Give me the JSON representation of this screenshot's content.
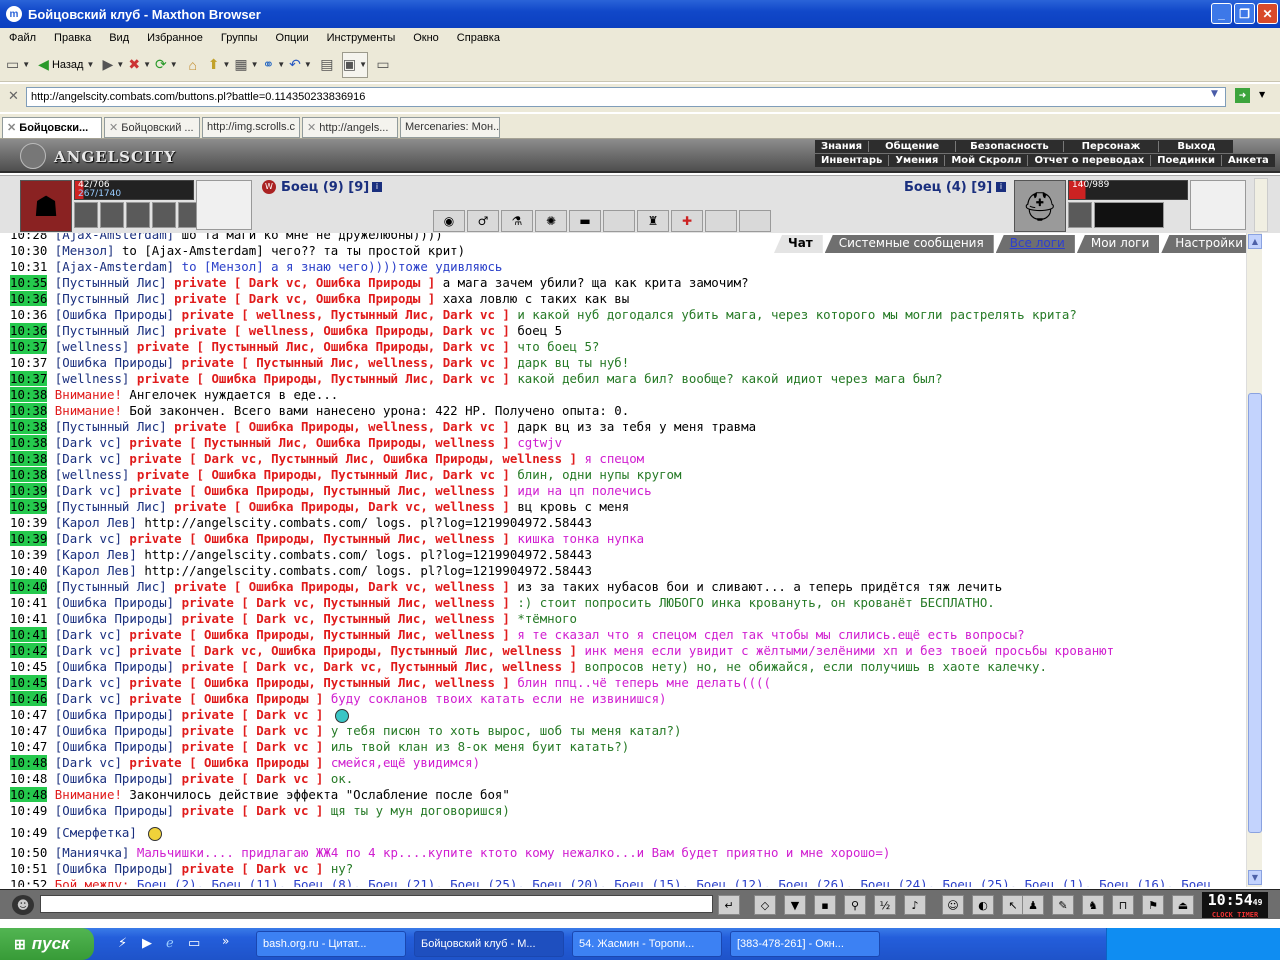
{
  "window": {
    "title": "Бойцовский клуб - Maxthon Browser",
    "app_icon": "m"
  },
  "menu": [
    "Файл",
    "Правка",
    "Вид",
    "Избранное",
    "Группы",
    "Опции",
    "Инструменты",
    "Окно",
    "Справка"
  ],
  "toolbar": {
    "back_label": "Назад"
  },
  "address": {
    "url": "http://angelscity.combats.com/buttons.pl?battle=0.114350233836916"
  },
  "tabs": [
    "Бойцовски...",
    "Бойцовский ...",
    "http://img.scrolls.c",
    "http://angels...",
    "Mercenaries: Мон..."
  ],
  "game": {
    "logo": "ANGELSCITY",
    "nav_top": [
      "Знания",
      "Общение",
      "Безопасность",
      "Персонаж",
      "Выход"
    ],
    "nav_bottom": [
      "Инвентарь",
      "Умения",
      "Мой Скролл",
      "Отчет о переводах",
      "Поединки",
      "Анкета"
    ],
    "left_fighter": {
      "name": "Боец (9) [9]",
      "hp": "42/706",
      "mana": "267/1740"
    },
    "right_fighter": {
      "name": "Боец (4) [9]",
      "hp": "140/989"
    }
  },
  "chat_tabs": [
    "Чат",
    "Системные сообщения",
    "Все логи",
    "Мои логи",
    "Настройки"
  ],
  "chat": [
    {
      "time": "10:28",
      "hl": false,
      "nick": "[Ajax-Amsterdam]",
      "text": "шо та маги ко мне не дружелюбны))))",
      "cls": "msg-default"
    },
    {
      "time": "10:30",
      "hl": false,
      "nick": "[Мензол]",
      "text": "to [Ajax-Amsterdam] чего?? та ты простой крит)",
      "cls": "msg-default"
    },
    {
      "time": "10:31",
      "hl": false,
      "nick": "[Ajax-Amsterdam]",
      "text": "to [Мензол] а я знаю чего))))тоже удивляюсь",
      "cls": "msg-blue"
    },
    {
      "time": "10:35",
      "hl": true,
      "nick": "[Пустынный Лис]",
      "priv": "private [ Dark vc, Ошибка Природы ]",
      "text": "а мага зачем убили? ща как крита замочим?",
      "cls": "msg-default"
    },
    {
      "time": "10:36",
      "hl": true,
      "nick": "[Пустынный Лис]",
      "priv": "private [ Dark vc, Ошибка Природы ]",
      "text": "хаха ловлю с таких как вы",
      "cls": "msg-default"
    },
    {
      "time": "10:36",
      "hl": false,
      "nick": "[Ошибка Природы]",
      "priv": "private [ wellness, Пустынный Лис, Dark vc ]",
      "text": "и какой нуб догодался убить мага, через которого мы могли растрелять крита?",
      "cls": "msg-green"
    },
    {
      "time": "10:36",
      "hl": true,
      "nick": "[Пустынный Лис]",
      "priv": "private [ wellness, Ошибка Природы, Dark vc ]",
      "text": "боец 5",
      "cls": "msg-default"
    },
    {
      "time": "10:37",
      "hl": true,
      "nick": "[wellness]",
      "priv": "private [ Пустынный Лис, Ошибка Природы, Dark vc ]",
      "text": "что боец 5?",
      "cls": "msg-green"
    },
    {
      "time": "10:37",
      "hl": false,
      "nick": "[Ошибка Природы]",
      "priv": "private [ Пустынный Лис, wellness, Dark vc ]",
      "text": "дарк вц ты нуб!",
      "cls": "msg-green"
    },
    {
      "time": "10:37",
      "hl": true,
      "nick": "[wellness]",
      "priv": "private [ Ошибка Природы, Пустынный Лис, Dark vc ]",
      "text": "какой дебил мага бил? вообще? какой идиот через мага был?",
      "cls": "msg-green"
    },
    {
      "time": "10:38",
      "hl": true,
      "att": "Внимание!",
      "text": "Ангелочек нуждается в еде...",
      "cls": "msg-default"
    },
    {
      "time": "10:38",
      "hl": true,
      "att": "Внимание!",
      "text": "Бой закончен. Всего вами нанесено урона: 422 HP. Получено опыта: 0.",
      "cls": "msg-default"
    },
    {
      "time": "10:38",
      "hl": true,
      "nick": "[Пустынный Лис]",
      "priv": "private [ Ошибка Природы, wellness, Dark vc ]",
      "text": "дарк вц из за тебя у меня травма",
      "cls": "msg-default"
    },
    {
      "time": "10:38",
      "hl": true,
      "nick": "[Dark vc]",
      "priv": "private [ Пустынный Лис, Ошибка Природы, wellness ]",
      "text": "cgtwjv",
      "cls": "msg-pink"
    },
    {
      "time": "10:38",
      "hl": true,
      "nick": "[Dark vc]",
      "priv": "private [ Dark vc, Пустынный Лис, Ошибка Природы, wellness ]",
      "text": "я спецом",
      "cls": "msg-pink"
    },
    {
      "time": "10:38",
      "hl": true,
      "nick": "[wellness]",
      "priv": "private [ Ошибка Природы, Пустынный Лис, Dark vc ]",
      "text": "блин, одни нупы кругом",
      "cls": "msg-green"
    },
    {
      "time": "10:39",
      "hl": true,
      "nick": "[Dark vc]",
      "priv": "private [ Ошибка Природы, Пустынный Лис, wellness ]",
      "text": "иди на цп полечись",
      "cls": "msg-pink"
    },
    {
      "time": "10:39",
      "hl": true,
      "nick": "[Пустынный Лис]",
      "priv": "private [ Ошибка Природы, Dark vc, wellness ]",
      "text": "вц кровь с меня",
      "cls": "msg-default"
    },
    {
      "time": "10:39",
      "hl": false,
      "nick": "[Карол Лев]",
      "text": "http://angelscity.combats.com/ logs. pl?log=1219904972.58443",
      "cls": "msg-default"
    },
    {
      "time": "10:39",
      "hl": true,
      "nick": "[Dark vc]",
      "priv": "private [ Ошибка Природы, Пустынный Лис, wellness ]",
      "text": "кишка тонка нупка",
      "cls": "msg-pink"
    },
    {
      "time": "10:39",
      "hl": false,
      "nick": "[Карол Лев]",
      "text": "http://angelscity.combats.com/ logs. pl?log=1219904972.58443",
      "cls": "msg-default"
    },
    {
      "time": "10:40",
      "hl": false,
      "nick": "[Карол Лев]",
      "text": "http://angelscity.combats.com/ logs. pl?log=1219904972.58443",
      "cls": "msg-default"
    },
    {
      "time": "10:40",
      "hl": true,
      "nick": "[Пустынный Лис]",
      "priv": "private [ Ошибка Природы, Dark vc, wellness ]",
      "text": "из за таких нубасов бои и сливают... а теперь придётся тяж лечить",
      "cls": "msg-default"
    },
    {
      "time": "10:41",
      "hl": false,
      "nick": "[Ошибка Природы]",
      "priv": "private [ Dark vc, Пустынный Лис, wellness ]",
      "text": ":) стоит попросить ЛЮБОГО инка кровануть, он крованёт БЕСПЛАТНО.",
      "cls": "msg-green"
    },
    {
      "time": "10:41",
      "hl": false,
      "nick": "[Ошибка Природы]",
      "priv": "private [ Dark vc, Пустынный Лис, wellness ]",
      "text": "*тёмного",
      "cls": "msg-green"
    },
    {
      "time": "10:41",
      "hl": true,
      "nick": "[Dark vc]",
      "priv": "private [ Ошибка Природы, Пустынный Лис, wellness ]",
      "text": "я те сказал что я спецом сдел так чтобы мы слились.ещё есть вопросы?",
      "cls": "msg-pink"
    },
    {
      "time": "10:42",
      "hl": true,
      "nick": "[Dark vc]",
      "priv": "private [ Dark vc, Ошибка Природы, Пустынный Лис, wellness ]",
      "text": "инк меня если увидит с жёлтыми/зелёними хп и без твоей просьбы крованют",
      "cls": "msg-pink"
    },
    {
      "time": "10:45",
      "hl": false,
      "nick": "[Ошибка Природы]",
      "priv": "private [ Dark vc, Dark vc, Пустынный Лис, wellness ]",
      "text": "вопросов нету) но, не обижайся, если получишь в хаоте калечку.",
      "cls": "msg-green"
    },
    {
      "time": "10:45",
      "hl": true,
      "nick": "[Dark vc]",
      "priv": "private [ Ошибка Природы, Пустынный Лис, wellness ]",
      "text": "блин ппц..чё теперь мне делать((((",
      "cls": "msg-pink"
    },
    {
      "time": "10:46",
      "hl": true,
      "nick": "[Dark vc]",
      "priv": "private [ Ошибка Природы ]",
      "text": "буду сокланов твоих катать если не извинишся)",
      "cls": "msg-pink"
    },
    {
      "time": "10:47",
      "hl": false,
      "nick": "[Ошибка Природы]",
      "priv": "private [ Dark vc ]",
      "text": "",
      "cls": "msg-green",
      "smiley": true
    },
    {
      "time": "10:47",
      "hl": false,
      "nick": "[Ошибка Природы]",
      "priv": "private [ Dark vc ]",
      "text": "у тебя писюн то хоть вырос, шоб ты меня катал?)",
      "cls": "msg-green"
    },
    {
      "time": "10:47",
      "hl": false,
      "nick": "[Ошибка Природы]",
      "priv": "private [ Dark vc ]",
      "text": "иль твой клан из 8-ок меня буит катать?)",
      "cls": "msg-green"
    },
    {
      "time": "10:48",
      "hl": true,
      "nick": "[Dark vc]",
      "priv": "private [ Ошибка Природы ]",
      "text": "смейся,ещё увидимся)",
      "cls": "msg-pink"
    },
    {
      "time": "10:48",
      "hl": false,
      "nick": "[Ошибка Природы]",
      "priv": "private [ Dark vc ]",
      "text": "ок.",
      "cls": "msg-green"
    },
    {
      "time": "10:48",
      "hl": true,
      "att": "Внимание!",
      "text": "Закончилось действие эффекта \"Ослабление после боя\"",
      "cls": "msg-default"
    },
    {
      "time": "10:49",
      "hl": false,
      "nick": "[Ошибка Природы]",
      "priv": "private [ Dark vc ]",
      "text": "щя ты у мун договоришся)",
      "cls": "msg-green"
    },
    {
      "time": "10:49",
      "hl": false,
      "nick": "[Смерфетка]",
      "text": "",
      "cls": "msg-default",
      "smiley2": true
    },
    {
      "time": "10:50",
      "hl": false,
      "nick": "[Маниячка]",
      "text": "Мальчишки.... придлагаю ЖЖ4 по 4 кр....купите ктото кому нежалко...и Вам будет приятно и мне хорошо=)",
      "cls": "msg-pink"
    },
    {
      "time": "10:51",
      "hl": false,
      "nick": "[Ошибка Природы]",
      "priv": "private [ Dark vc ]",
      "text": "ну?",
      "cls": "msg-green"
    },
    {
      "time": "10:52",
      "hl": false,
      "att": "Бой между:",
      "text": "Боец (2), Боец (11), Боец (8), Боец (21), Боец (25), Боец (20), Боец (15), Боец (12), Боец (26), Боец (24), Боец (25), Боец (1), Боец (16), Боец",
      "cls": "msg-blue"
    }
  ],
  "clock": {
    "time": "10:54",
    "seconds": "49",
    "label": "CLOCK TIMER"
  },
  "taskbar": {
    "start": "пуск",
    "tasks": [
      "bash.org.ru - Цитат...",
      "Бойцовский клуб - M...",
      "54. Жасмин - Торопи...",
      "[383-478-261] - Окн..."
    ]
  }
}
